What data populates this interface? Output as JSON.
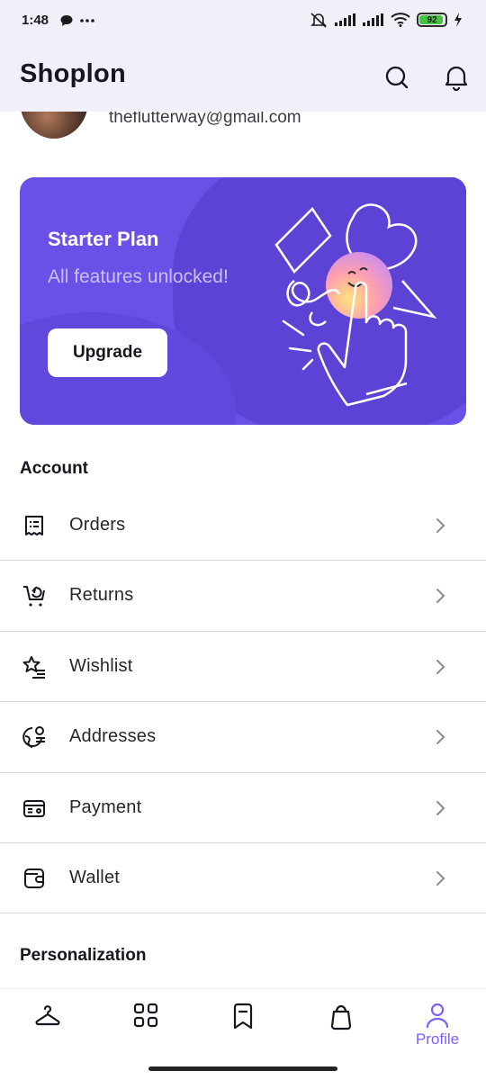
{
  "status_bar": {
    "time": "1:48",
    "battery": "92",
    "icons": [
      "chat-bubble-icon",
      "more-dots-icon",
      "mute-icon",
      "signal-icon",
      "signal-icon",
      "wifi-icon",
      "battery-icon",
      "charging-icon"
    ]
  },
  "app_bar": {
    "title": "Shoplon",
    "actions": [
      "search-icon",
      "bell-icon"
    ]
  },
  "profile": {
    "email": "theflutterway@gmail.com"
  },
  "plan_card": {
    "title": "Starter Plan",
    "subtitle": "All features unlocked!",
    "button_label": "Upgrade",
    "color": "#6a50e6"
  },
  "account": {
    "section_title": "Account",
    "items": [
      {
        "label": "Orders",
        "icon": "receipt-icon"
      },
      {
        "label": "Returns",
        "icon": "cart-return-icon"
      },
      {
        "label": "Wishlist",
        "icon": "star-list-icon"
      },
      {
        "label": "Addresses",
        "icon": "globe-pin-icon"
      },
      {
        "label": "Payment",
        "icon": "card-icon"
      },
      {
        "label": "Wallet",
        "icon": "wallet-icon"
      }
    ]
  },
  "personalization": {
    "section_title": "Personalization"
  },
  "bottom_nav": {
    "items": [
      {
        "name": "shop",
        "icon": "hanger-icon",
        "label": ""
      },
      {
        "name": "discover",
        "icon": "grid-icon",
        "label": ""
      },
      {
        "name": "bookmark",
        "icon": "bookmark-icon",
        "label": ""
      },
      {
        "name": "bag",
        "icon": "bag-icon",
        "label": ""
      },
      {
        "name": "profile",
        "icon": "person-icon",
        "label": "Profile",
        "active": true
      }
    ],
    "active_color": "#7b61ff"
  }
}
